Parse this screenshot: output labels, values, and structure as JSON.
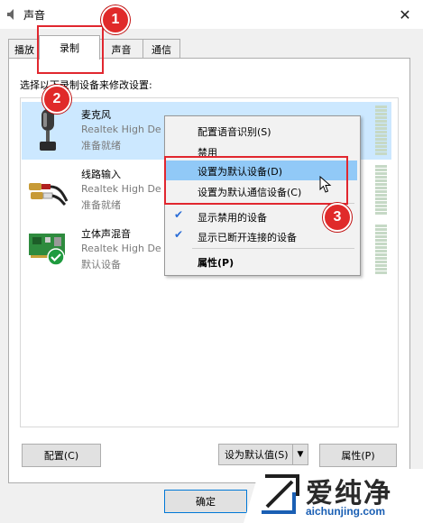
{
  "window": {
    "title": "声音"
  },
  "tabs": [
    {
      "label": "播放"
    },
    {
      "label": "录制"
    },
    {
      "label": "声音"
    },
    {
      "label": "通信"
    }
  ],
  "instruction": "选择以下录制设备来修改设置:",
  "devices": [
    {
      "name": "麦克风",
      "driver": "Realtek High De",
      "status": "准备就绪",
      "icon": "microphone-icon",
      "selected": true
    },
    {
      "name": "线路输入",
      "driver": "Realtek High De",
      "status": "准备就绪",
      "icon": "line-in-icon",
      "selected": false
    },
    {
      "name": "立体声混音",
      "driver": "Realtek High De",
      "status": "默认设备",
      "icon": "sound-card-icon",
      "selected": false
    }
  ],
  "context_menu": {
    "items": [
      {
        "label": "配置语音识别(S)"
      },
      {
        "label": "禁用"
      },
      {
        "label": "设置为默认设备(D)"
      },
      {
        "label": "设置为默认通信设备(C)"
      },
      {
        "label": "显示禁用的设备",
        "checked": true
      },
      {
        "label": "显示已断开连接的设备",
        "checked": true
      },
      {
        "label": "属性(P)"
      }
    ]
  },
  "buttons": {
    "configure": "配置(C)",
    "set_default": "设为默认值(S)",
    "properties": "属性(P)",
    "ok": "确定"
  },
  "annotations": [
    "1",
    "2",
    "3"
  ],
  "watermark": {
    "text": "爱纯净",
    "url": "aichunjing.com"
  },
  "colors": {
    "selection": "#cce8ff",
    "menu_highlight": "#91c9f7",
    "annotation_red": "#e1272f",
    "check_blue": "#2b6dd6"
  }
}
